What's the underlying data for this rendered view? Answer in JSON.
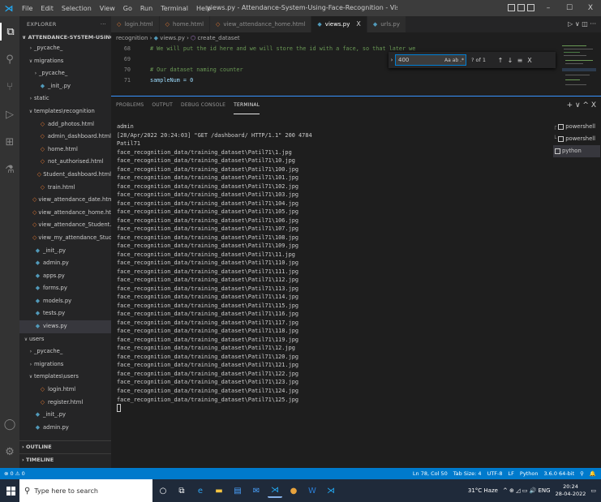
{
  "window": {
    "title": "views.py - Attendance-System-Using-Face-Recognition - Visual Studio Code",
    "menu": [
      "File",
      "Edit",
      "Selection",
      "View",
      "Go",
      "Run",
      "Terminal",
      "Help"
    ],
    "controls": {
      "minimize": "–",
      "maximize": "☐",
      "close": "X"
    }
  },
  "sidebar": {
    "header": "EXPLORER",
    "more": "···",
    "project": "ATTENDANCE-SYSTEM-USING-FACE-R...",
    "items": [
      {
        "label": "_pycache_",
        "twisty": "›",
        "indent": 10,
        "icon": ""
      },
      {
        "label": "migrations",
        "twisty": "∨",
        "indent": 10,
        "icon": ""
      },
      {
        "label": "_pycache_",
        "twisty": "›",
        "indent": 16,
        "icon": ""
      },
      {
        "label": "_init_.py",
        "twisty": "",
        "indent": 16,
        "icon": "py"
      },
      {
        "label": "static",
        "twisty": "›",
        "indent": 10,
        "icon": ""
      },
      {
        "label": "templates\\recognition",
        "twisty": "∨",
        "indent": 10,
        "icon": ""
      },
      {
        "label": "add_photos.html",
        "twisty": "",
        "indent": 16,
        "icon": "html"
      },
      {
        "label": "admin_dashboard.html",
        "twisty": "",
        "indent": 16,
        "icon": "html"
      },
      {
        "label": "home.html",
        "twisty": "",
        "indent": 16,
        "icon": "html"
      },
      {
        "label": "not_authorised.html",
        "twisty": "",
        "indent": 16,
        "icon": "html"
      },
      {
        "label": "Student_dashboard.html",
        "twisty": "",
        "indent": 16,
        "icon": "html"
      },
      {
        "label": "train.html",
        "twisty": "",
        "indent": 16,
        "icon": "html"
      },
      {
        "label": "view_attendance_date.html",
        "twisty": "",
        "indent": 16,
        "icon": "html"
      },
      {
        "label": "view_attendance_home.html",
        "twisty": "",
        "indent": 16,
        "icon": "html"
      },
      {
        "label": "view_attendance_Student.html",
        "twisty": "",
        "indent": 16,
        "icon": "html"
      },
      {
        "label": "view_my_attendance_Student...",
        "twisty": "",
        "indent": 16,
        "icon": "html"
      },
      {
        "label": "_init_.py",
        "twisty": "",
        "indent": 10,
        "icon": "py"
      },
      {
        "label": "admin.py",
        "twisty": "",
        "indent": 10,
        "icon": "py"
      },
      {
        "label": "apps.py",
        "twisty": "",
        "indent": 10,
        "icon": "py"
      },
      {
        "label": "forms.py",
        "twisty": "",
        "indent": 10,
        "icon": "py"
      },
      {
        "label": "models.py",
        "twisty": "",
        "indent": 10,
        "icon": "py"
      },
      {
        "label": "tests.py",
        "twisty": "",
        "indent": 10,
        "icon": "py"
      },
      {
        "label": "views.py",
        "twisty": "",
        "indent": 10,
        "icon": "py",
        "selected": true
      },
      {
        "label": "users",
        "twisty": "∨",
        "indent": 4,
        "icon": ""
      },
      {
        "label": "_pycache_",
        "twisty": "›",
        "indent": 10,
        "icon": ""
      },
      {
        "label": "migrations",
        "twisty": "›",
        "indent": 10,
        "icon": ""
      },
      {
        "label": "templates\\users",
        "twisty": "∨",
        "indent": 10,
        "icon": ""
      },
      {
        "label": "login.html",
        "twisty": "",
        "indent": 16,
        "icon": "html"
      },
      {
        "label": "register.html",
        "twisty": "",
        "indent": 16,
        "icon": "html"
      },
      {
        "label": "_init_.py",
        "twisty": "",
        "indent": 10,
        "icon": "py"
      },
      {
        "label": "admin.py",
        "twisty": "",
        "indent": 10,
        "icon": "py"
      }
    ],
    "outline": "OUTLINE",
    "timeline": "TIMELINE"
  },
  "tabs": [
    {
      "label": "login.html",
      "icon": "html",
      "active": false
    },
    {
      "label": "home.html",
      "icon": "html",
      "active": false
    },
    {
      "label": "view_attendance_home.html",
      "icon": "html",
      "active": false
    },
    {
      "label": "views.py",
      "icon": "py",
      "active": true,
      "close": "X"
    },
    {
      "label": "urls.py",
      "icon": "py",
      "active": false
    }
  ],
  "editor_actions": "▷ ∨  ◫  ···",
  "breadcrumb": {
    "folder": "recognition",
    "sep": " › ",
    "file": "views.py",
    "symbol": "create_dataset"
  },
  "code_lines": [
    {
      "n": "68",
      "text": "# We will put the id here and we will store the id with a face, so that later we",
      "type": "comment"
    },
    {
      "n": "69",
      "text": "",
      "type": "plain"
    },
    {
      "n": "70",
      "text": "# Our dataset naming counter",
      "type": "comment"
    },
    {
      "n": "71",
      "text": "sampleNum = 0",
      "type": "assign"
    }
  ],
  "find": {
    "toggle": "›",
    "value": "400",
    "options": "Aa ab .*",
    "count": "? of 1",
    "up": "↑",
    "down": "↓",
    "menu": "≡",
    "close": "X"
  },
  "panel": {
    "tabs": [
      "PROBLEMS",
      "OUTPUT",
      "DEBUG CONSOLE",
      "TERMINAL"
    ],
    "active_tab": "TERMINAL",
    "actions": "+ ∨ ^ X"
  },
  "terminal_lines": [
    "admin",
    "[28/Apr/2022 20:24:03] \"GET /dashboard/ HTTP/1.1\" 200 4784",
    "Patil71",
    "face_recognition_data/training_dataset\\Patil71\\1.jpg",
    "face_recognition_data/training_dataset\\Patil71\\10.jpg",
    "face_recognition_data/training_dataset\\Patil71\\100.jpg",
    "face_recognition_data/training_dataset\\Patil71\\101.jpg",
    "face_recognition_data/training_dataset\\Patil71\\102.jpg",
    "face_recognition_data/training_dataset\\Patil71\\103.jpg",
    "face_recognition_data/training_dataset\\Patil71\\104.jpg",
    "face_recognition_data/training_dataset\\Patil71\\105.jpg",
    "face_recognition_data/training_dataset\\Patil71\\106.jpg",
    "face_recognition_data/training_dataset\\Patil71\\107.jpg",
    "face_recognition_data/training_dataset\\Patil71\\108.jpg",
    "face_recognition_data/training_dataset\\Patil71\\109.jpg",
    "face_recognition_data/training_dataset\\Patil71\\11.jpg",
    "face_recognition_data/training_dataset\\Patil71\\110.jpg",
    "face_recognition_data/training_dataset\\Patil71\\111.jpg",
    "face_recognition_data/training_dataset\\Patil71\\112.jpg",
    "face_recognition_data/training_dataset\\Patil71\\113.jpg",
    "face_recognition_data/training_dataset\\Patil71\\114.jpg",
    "face_recognition_data/training_dataset\\Patil71\\115.jpg",
    "face_recognition_data/training_dataset\\Patil71\\116.jpg",
    "face_recognition_data/training_dataset\\Patil71\\117.jpg",
    "face_recognition_data/training_dataset\\Patil71\\118.jpg",
    "face_recognition_data/training_dataset\\Patil71\\119.jpg",
    "face_recognition_data/training_dataset\\Patil71\\12.jpg",
    "face_recognition_data/training_dataset\\Patil71\\120.jpg",
    "face_recognition_data/training_dataset\\Patil71\\121.jpg",
    "face_recognition_data/training_dataset\\Patil71\\122.jpg",
    "face_recognition_data/training_dataset\\Patil71\\123.jpg",
    "face_recognition_data/training_dataset\\Patil71\\124.jpg",
    "face_recognition_data/training_dataset\\Patil71\\125.jpg"
  ],
  "terminal_list": [
    {
      "tree": "┌",
      "label": "powershell",
      "active": false
    },
    {
      "tree": "└",
      "label": "powershell",
      "active": false
    },
    {
      "tree": "",
      "label": "python",
      "active": true
    }
  ],
  "status": {
    "left": "⊗ 0 ⚠ 0",
    "items": [
      "Ln 78, Col 50",
      "Tab Size: 4",
      "UTF-8",
      "LF",
      "Python",
      "3.6.0 64-bit",
      "⚲",
      "🔔"
    ]
  },
  "taskbar": {
    "search_placeholder": "Type here to search",
    "apps": [
      {
        "name": "cortana",
        "glyph": "○",
        "color": "#ffffff"
      },
      {
        "name": "task-view",
        "glyph": "⧉",
        "color": "#ffffff"
      },
      {
        "name": "edge",
        "glyph": "e",
        "color": "#2fa3f0"
      },
      {
        "name": "file-explorer",
        "glyph": "▬",
        "color": "#f5c542"
      },
      {
        "name": "calendar",
        "glyph": "▤",
        "color": "#4aa3ff"
      },
      {
        "name": "mail",
        "glyph": "✉",
        "color": "#4aa3ff"
      },
      {
        "name": "vscode",
        "glyph": "⋊",
        "color": "#23a9f2",
        "active": true
      },
      {
        "name": "chrome",
        "glyph": "●",
        "color": "#e8a33d"
      },
      {
        "name": "word",
        "glyph": "W",
        "color": "#2b7cd3"
      },
      {
        "name": "store",
        "glyph": "⋊",
        "color": "#23a9f2"
      }
    ],
    "weather": "31°C  Haze",
    "tray": "^  ⊕  ◿  ▭  🔊  ENG",
    "time": "20:24",
    "date": "28-04-2022",
    "notify": "▭"
  }
}
